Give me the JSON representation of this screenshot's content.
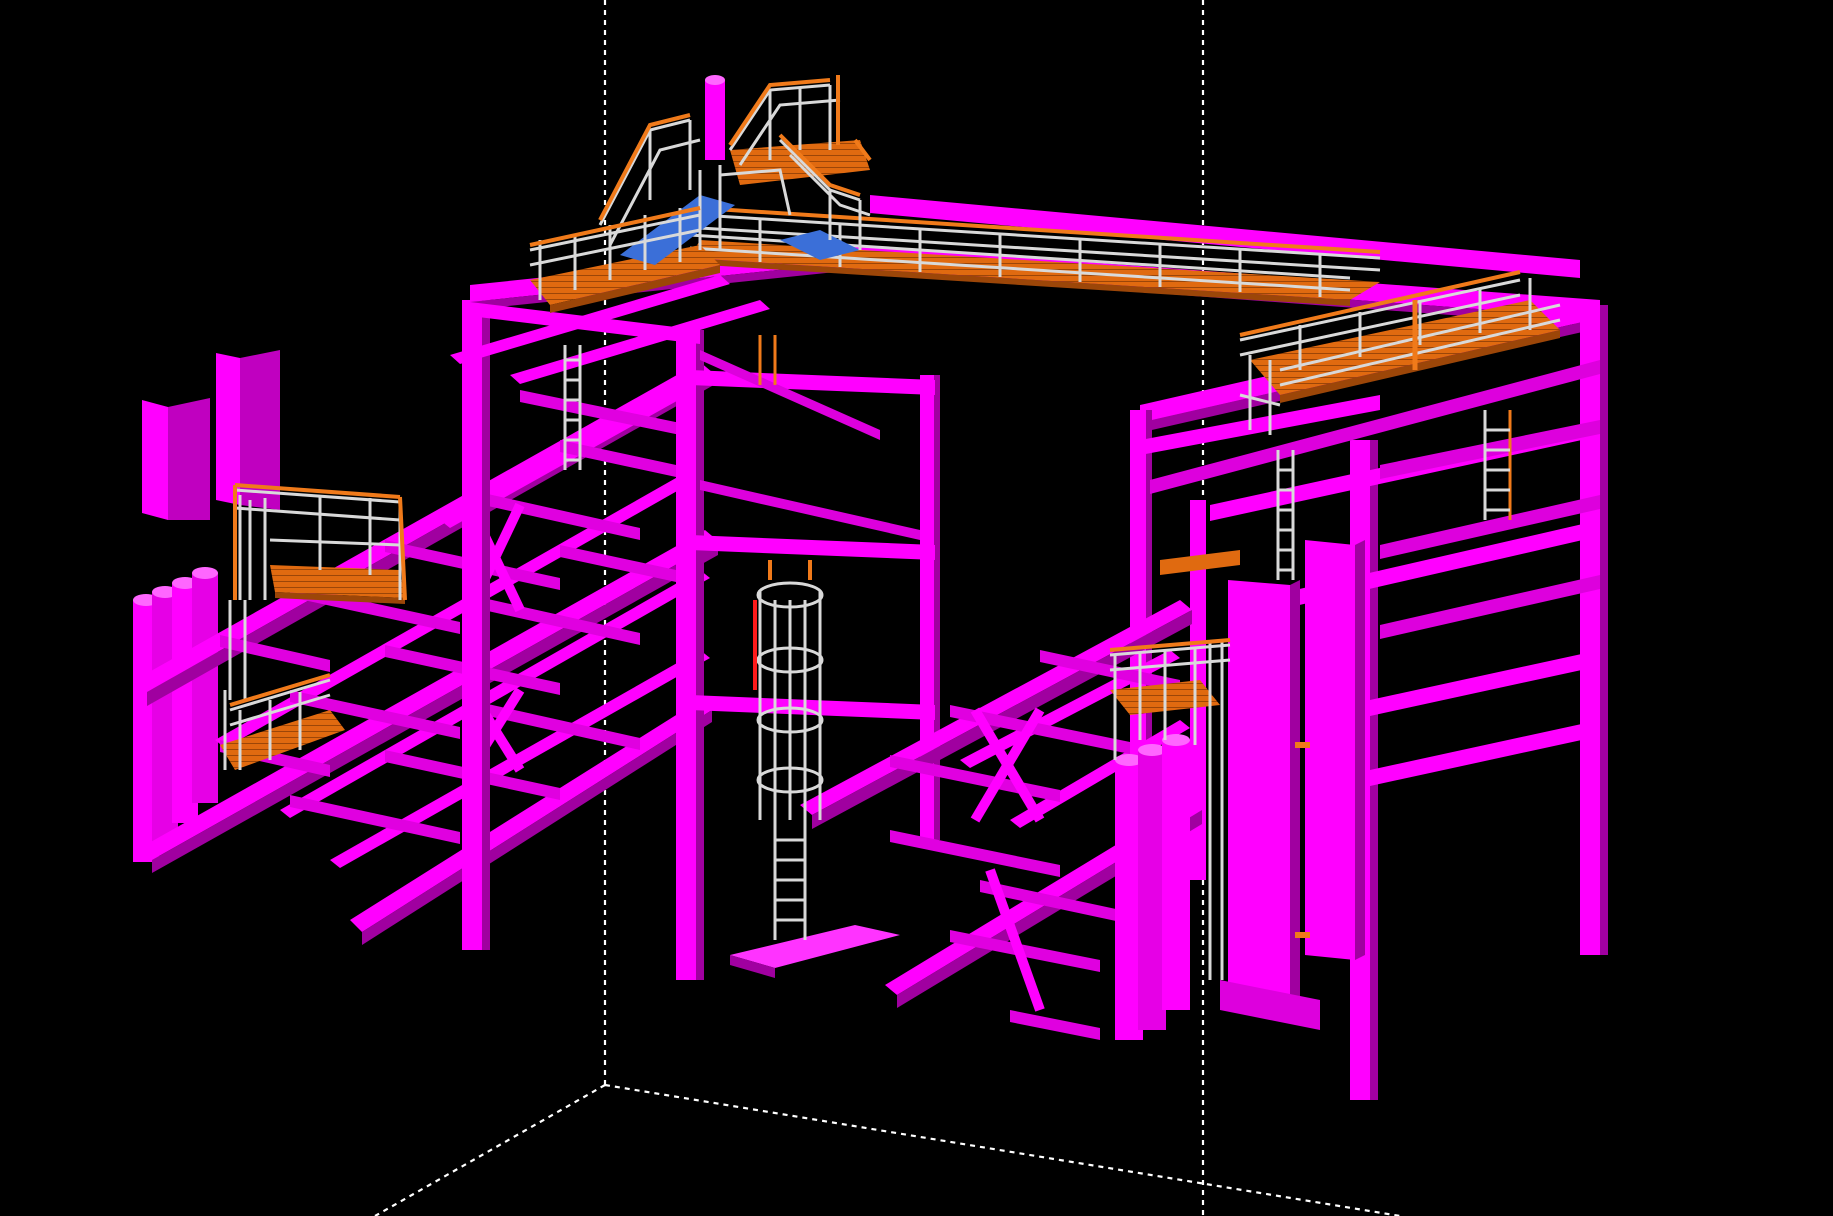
{
  "viewport": {
    "background": "#000000",
    "view_mode": "3D model view",
    "colors": {
      "steel_member": "#ff00ff",
      "steel_member_shade": "#b400b4",
      "steel_member_dark": "#8a008a",
      "grating": "#e06a10",
      "handrail": "#d9d9d9",
      "handrail_accent": "#f07a1a",
      "stair_tread": "#3b6fd8",
      "work_box_line": "#ffffff",
      "red_part": "#ff1a1a"
    }
  },
  "model": {
    "objects": [
      "main-frame",
      "left-wing-grid",
      "right-wing-grid",
      "top-bridge-walkway",
      "top-left-platform-stair",
      "top-right-platform",
      "left-upper-platform",
      "left-lower-platform",
      "center-cage-ladder",
      "right-mid-platform",
      "vertical-ladders",
      "pipe-columns",
      "base-plate"
    ]
  }
}
